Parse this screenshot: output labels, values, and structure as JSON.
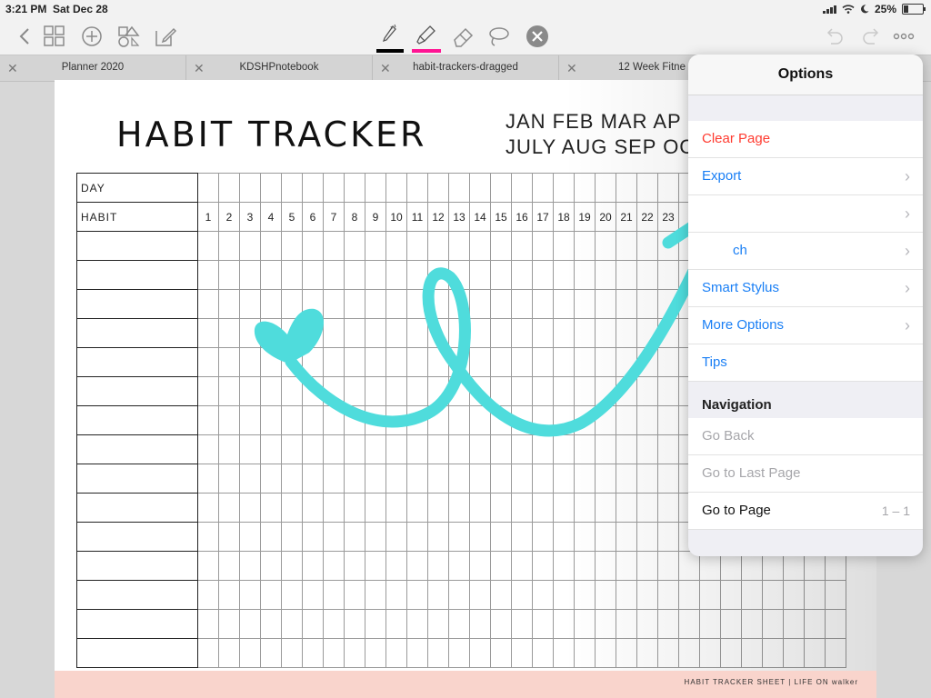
{
  "status": {
    "time": "3:21 PM",
    "date": "Sat Dec 28",
    "battery": "25%",
    "battery_level": 0.25
  },
  "toolbar": {
    "icons": [
      "back-icon",
      "grid-icon",
      "add-icon",
      "shapes-icon",
      "edit-icon",
      "pen-icon",
      "highlighter-icon",
      "eraser-icon",
      "lasso-icon",
      "close-icon",
      "undo-icon",
      "redo-icon",
      "more-icon"
    ],
    "pen_color": "#000000",
    "highlighter_color": "#ff1493"
  },
  "tabs": [
    {
      "label": "Planner 2020"
    },
    {
      "label": "KDSHPnotebook"
    },
    {
      "label": "habit-trackers-dragged"
    },
    {
      "label": "12 Week Fitne"
    }
  ],
  "document": {
    "title": "HABIT TRACKER",
    "months_line1": "JAN FEB MAR AP",
    "months_line2": "JULY AUG SEP OC",
    "day_label": "DAY",
    "habit_label": "HABIT",
    "days": [
      "1",
      "2",
      "3",
      "4",
      "5",
      "6",
      "7",
      "8",
      "9",
      "10",
      "11",
      "12",
      "13",
      "14",
      "15",
      "16",
      "17",
      "18",
      "19",
      "20",
      "21",
      "22",
      "23",
      "",
      "",
      "",
      "",
      "",
      "",
      "",
      ""
    ],
    "footer": "HABIT TRACKER SHEET | LIFE ON walker"
  },
  "popover": {
    "title": "Options",
    "items": [
      {
        "label": "Clear Page",
        "color": "red",
        "chevron": false
      },
      {
        "label": "Export",
        "color": "blue",
        "chevron": true
      },
      {
        "label": "",
        "color": "blue",
        "chevron": true
      },
      {
        "label": "ch",
        "color": "blue",
        "chevron": true
      },
      {
        "label": "Smart Stylus",
        "color": "blue",
        "chevron": true
      },
      {
        "label": "More Options",
        "color": "blue",
        "chevron": true
      },
      {
        "label": "Tips",
        "color": "blue",
        "chevron": false
      }
    ],
    "nav_title": "Navigation",
    "nav_items": [
      {
        "label": "Go Back",
        "color": "gray"
      },
      {
        "label": "Go to Last Page",
        "color": "gray"
      },
      {
        "label": "Go to Page",
        "color": "dark",
        "value": "1 – 1"
      }
    ]
  },
  "colors": {
    "accent_blue": "#1a7ff5",
    "destructive_red": "#ff3b30",
    "scribble_teal": "#4fdcdc",
    "footer_pink": "#f9d4cc"
  }
}
